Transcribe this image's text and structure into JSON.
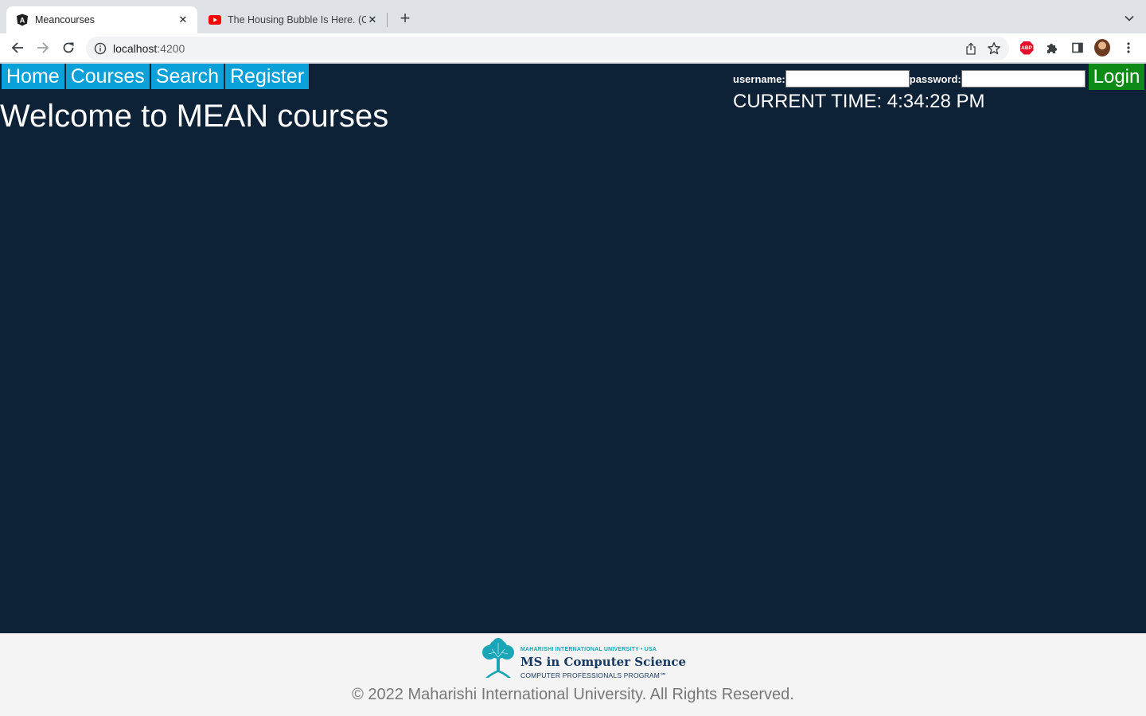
{
  "browser": {
    "tabs": [
      {
        "title": "Meancourses",
        "icon": "angular-icon",
        "active": true
      },
      {
        "title": "The Housing Bubble Is Here. (C",
        "icon": "youtube-icon",
        "active": false
      }
    ],
    "address": {
      "host": "localhost",
      "port": ":4200"
    },
    "extensions": [
      "adblock-plus-icon",
      "puzzle-icon",
      "sidepanel-icon",
      "profile-avatar"
    ]
  },
  "nav": {
    "items": [
      "Home",
      "Courses",
      "Search",
      "Register"
    ]
  },
  "main": {
    "heading": "Welcome to MEAN courses"
  },
  "login": {
    "username_label": "username:",
    "username_value": "",
    "password_label": "password:",
    "password_value": "",
    "button": "Login"
  },
  "clock": {
    "text": "CURRENT TIME: 4:34:28 PM"
  },
  "footer": {
    "logo_top": "MAHARISHI INTERNATIONAL UNIVERSITY • USA",
    "logo_main": "MS in Computer Science",
    "logo_sub": "COMPUTER PROFESSIONALS PROGRAM℠",
    "copyright": "© 2022 Maharishi International University. All Rights Reserved."
  },
  "colors": {
    "page_bg": "#0d2137",
    "nav_bg": "#0aa0d8",
    "login_bg": "#0e8a16",
    "footer_bg": "#f4f4f4"
  }
}
